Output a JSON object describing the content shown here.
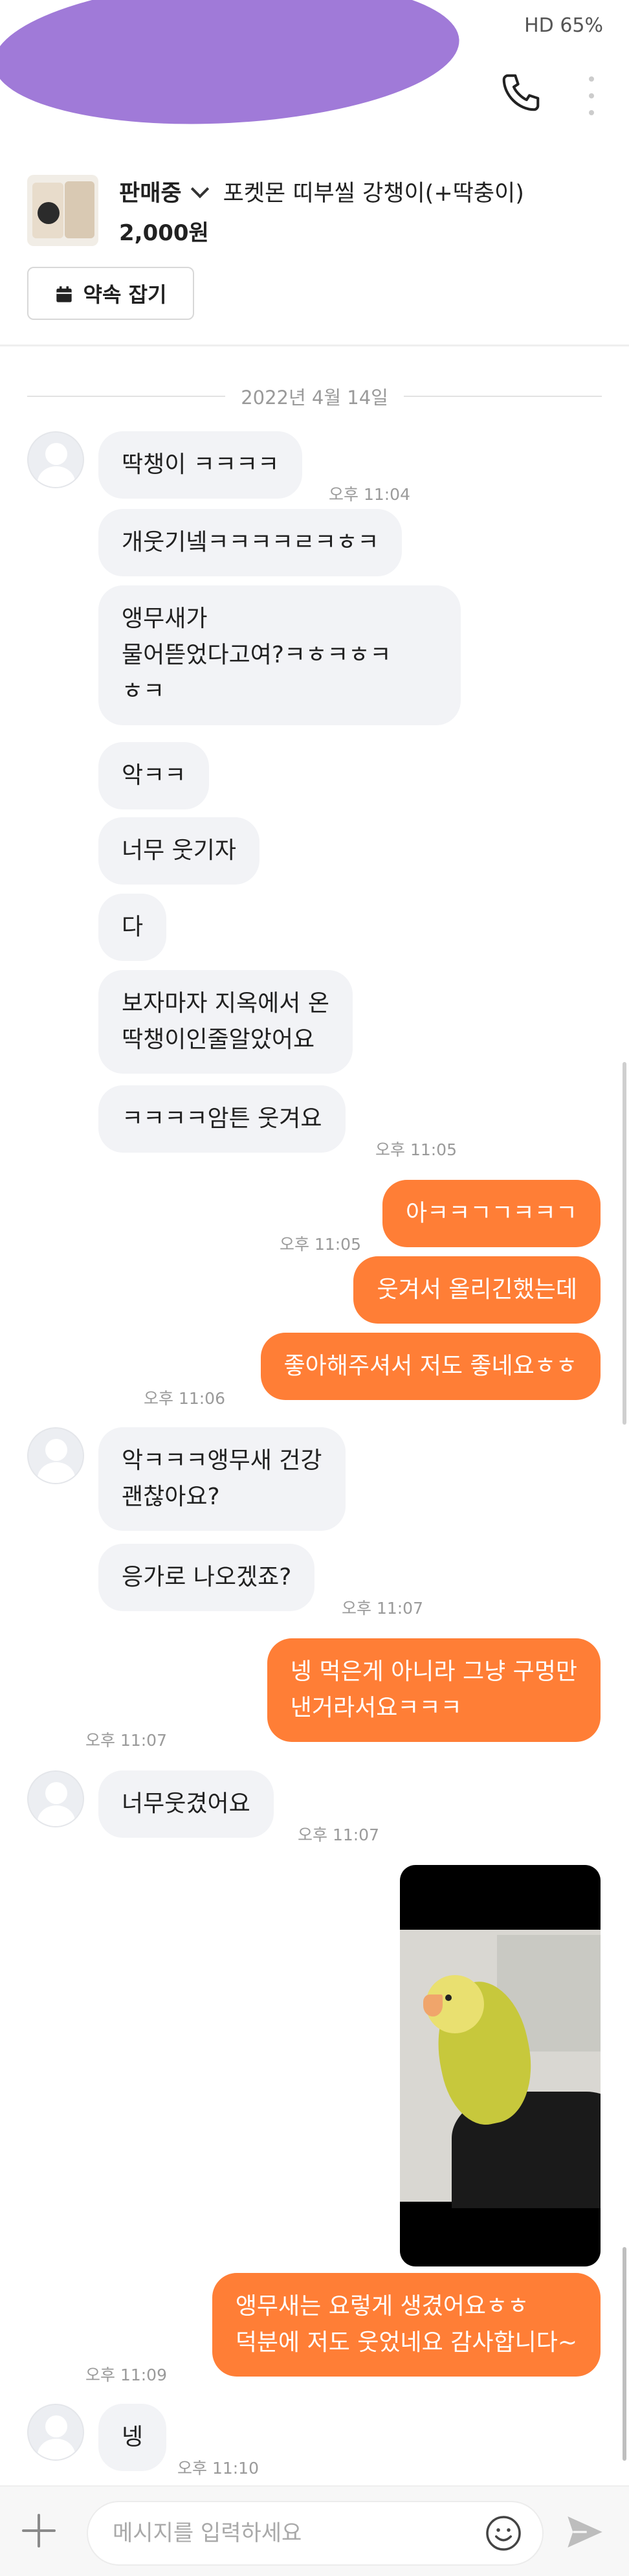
{
  "status_bar": {
    "indicators": "HD 65%",
    "battery_percent": "65%"
  },
  "header": {
    "call_icon": "phone-icon",
    "menu_icon": "kebab-menu-icon"
  },
  "product": {
    "status": "판매중",
    "title": "포켓몬 띠부씰 강챙이(+딱충이)",
    "price": "2,000원",
    "promise_button": "약속 잡기"
  },
  "date_separator": "2022년 4월 14일",
  "messages": {
    "m1": {
      "text": "딱챙이 ㅋㅋㅋㅋ",
      "time": "오후 11:04"
    },
    "m2": {
      "text": "개웃기넼ㅋㅋㅋㅋㄹㅋㅎㅋ"
    },
    "m3": {
      "line1": "앵무새가",
      "line2": "물어뜯었다고여?ㅋㅎㅋㅎㅋ",
      "line3": "ㅎㅋ"
    },
    "m4": {
      "text": "악ㅋㅋ"
    },
    "m5": {
      "text": "너무 웃기자"
    },
    "m6": {
      "text": "다"
    },
    "m7": {
      "line1": "보자마자 지옥에서 온",
      "line2": "딱챙이인줄알았어요"
    },
    "m8": {
      "text": "ㅋㅋㅋㅋ암튼 웃겨요",
      "time": "오후 11:05"
    },
    "o1": {
      "text": "아ㅋㅋㄱㄱㅋㅋㄱ",
      "time": "오후 11:05"
    },
    "o2": {
      "text": "웃겨서 올리긴했는데"
    },
    "o3": {
      "text": "좋아해주셔서 저도 좋네요ㅎㅎ",
      "time": "오후 11:06"
    },
    "m9": {
      "line1": "악ㅋㅋㅋ앵무새 건강",
      "line2": "괜찮아요?"
    },
    "m10": {
      "text": "응가로 나오겠죠?",
      "time": "오후 11:07"
    },
    "o4": {
      "line1": "넹 먹은게 아니라 그냥 구멍만",
      "line2": "낸거라서요ㅋㅋㅋ",
      "time": "오후 11:07"
    },
    "m11": {
      "text": "너무웃겼어요",
      "time": "오후 11:07"
    },
    "o5": {
      "line1": "앵무새는 요렇게 생겼어요ㅎㅎ",
      "line2": "덕분에 저도 웃었네요 감사합니다~",
      "time": "오후 11:09"
    },
    "m12": {
      "text": "넹",
      "time": "오후 11:10"
    }
  },
  "input_bar": {
    "placeholder": "메시지를 입력하세요",
    "plus_icon": "plus-icon",
    "emoji_icon": "emoji-icon",
    "send_icon": "send-icon"
  },
  "colors": {
    "accent": "#ff7e36",
    "incoming_bubble": "#f2f3f6",
    "redaction": "#a07ad8"
  }
}
